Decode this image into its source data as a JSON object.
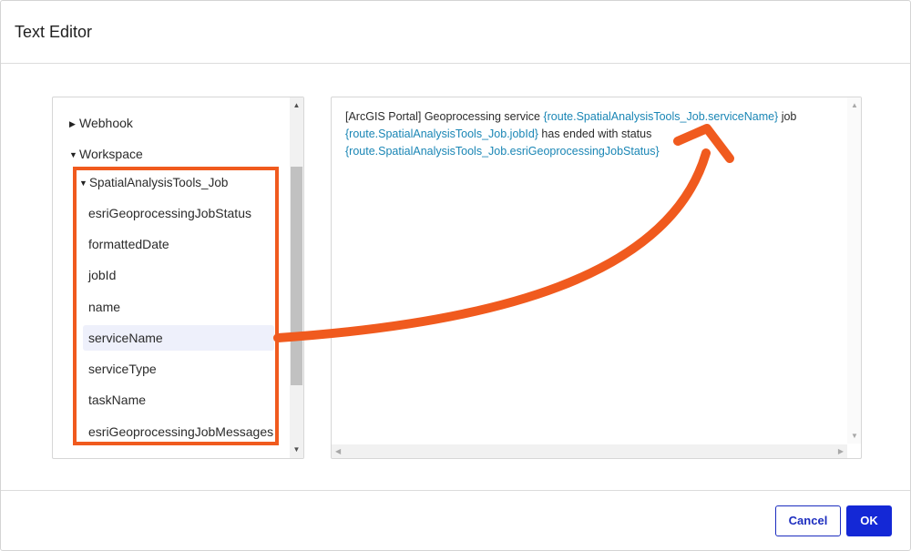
{
  "dialog": {
    "title": "Text Editor"
  },
  "tree": {
    "webhook": "Webhook",
    "workspace": "Workspace",
    "job": "SpatialAnalysisTools_Job",
    "fields": [
      "esriGeoprocessingJobStatus",
      "formattedDate",
      "jobId",
      "name",
      "serviceName",
      "serviceType",
      "taskName",
      "esriGeoprocessingJobMessages"
    ],
    "selected": "serviceName"
  },
  "editor": {
    "t1": "[ArcGIS Portal] Geoprocessing service ",
    "tok1": "{route.SpatialAnalysisTools_Job.serviceName}",
    "t2": " job ",
    "tok2": "{route.SpatialAnalysisTools_Job.jobId}",
    "t3": " has ended with status ",
    "tok3": "{route.SpatialAnalysisTools_Job.esriGeoprocessingJobStatus}"
  },
  "buttons": {
    "cancel": "Cancel",
    "ok": "OK"
  },
  "colors": {
    "accent": "#1428d6",
    "annotation": "#f05a1e",
    "token": "#1a86b5",
    "selected_bg": "#eef0fb"
  }
}
